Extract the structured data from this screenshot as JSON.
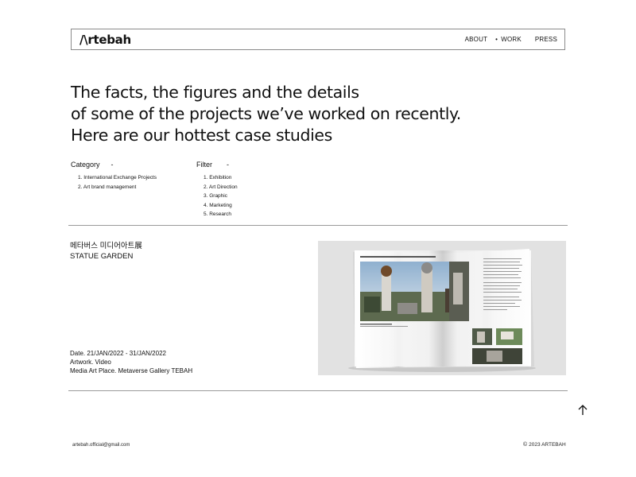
{
  "header": {
    "logo": "/\\rtebah",
    "nav": [
      {
        "label": "ABOUT"
      },
      {
        "label": "WORK",
        "active": true
      },
      {
        "label": "PRESS"
      }
    ]
  },
  "headline": [
    "The facts, the figures and the details",
    "of some of the projects we’ve worked on recently.",
    "Here are our hottest case studies"
  ],
  "category": {
    "title": "Category",
    "toggle": "-",
    "items": [
      "1. International Exchange Projects",
      "2. Art brand management"
    ]
  },
  "filter": {
    "title": "Filter",
    "toggle": "-",
    "items": [
      "1. Exhibition",
      "2. Art Direction",
      "3. Graphic",
      "4. Marketing",
      "5. Research"
    ]
  },
  "project": {
    "title_ko": "메타버스 미디어아트展",
    "title_en": "STATUE GARDEN",
    "date": "Date. 21/JAN/2022 - 31/JAN/2022",
    "artwork": "Artwork. Video",
    "place": "Media Art Place. Metaverse Gallery TEBAH"
  },
  "footer": {
    "email": "artebah.official@gmail.com",
    "copyright_icon": "©",
    "copyright": "2023 ARTEBAH"
  },
  "icons": {
    "scroll_top": "arrow-up-icon"
  },
  "colors": {
    "text": "#111111",
    "divider": "#9a9a9a",
    "preview_bg": "#e2e2e2"
  }
}
